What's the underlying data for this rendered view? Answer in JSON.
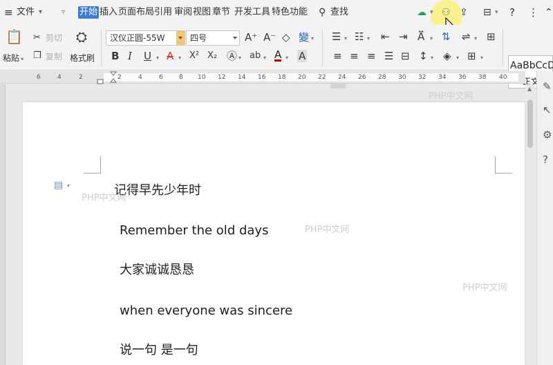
{
  "menubar": {
    "file_menu": "文件",
    "tabs": [
      {
        "label": "开始",
        "active": true
      },
      {
        "label": "插入"
      },
      {
        "label": "页面布局"
      },
      {
        "label": "引用"
      },
      {
        "label": "审阅"
      },
      {
        "label": "视图"
      },
      {
        "label": "章节"
      },
      {
        "label": "开发工具"
      },
      {
        "label": "特色功能"
      }
    ],
    "search_label": "查找",
    "help_glyph": "?",
    "more_glyph": "⋮",
    "active_tab_color": "#3d7bd9"
  },
  "ribbon": {
    "paste_label": "粘贴",
    "cut_label": "剪切",
    "copy_label": "复制",
    "format_painter_label": "格式刷",
    "font_name": "汉仪正圆-55W",
    "font_size": "四号",
    "bold": "B",
    "italic": "I",
    "underline": "U",
    "strike": "A",
    "superscript": "X²",
    "subscript": "X₂",
    "font_color": "A",
    "grow_font": "A⁺",
    "shrink_font": "A⁻",
    "style_preview": "AaBbCcD",
    "style_name": "正文"
  },
  "ruler": {
    "numbers": [
      "6",
      "4",
      "2",
      "2",
      "4",
      "6",
      "8",
      "10",
      "12",
      "14",
      "16",
      "18",
      "20",
      "22",
      "24",
      "26",
      "28",
      "30",
      "32",
      "34",
      "36",
      "38",
      "40"
    ]
  },
  "document": {
    "lines": [
      "记得早先少年时",
      "Remember the old days",
      "大家诚诚恳恳",
      "when everyone was sincere",
      "说一句  是一句"
    ]
  },
  "watermark_text": "PHP中文网"
}
